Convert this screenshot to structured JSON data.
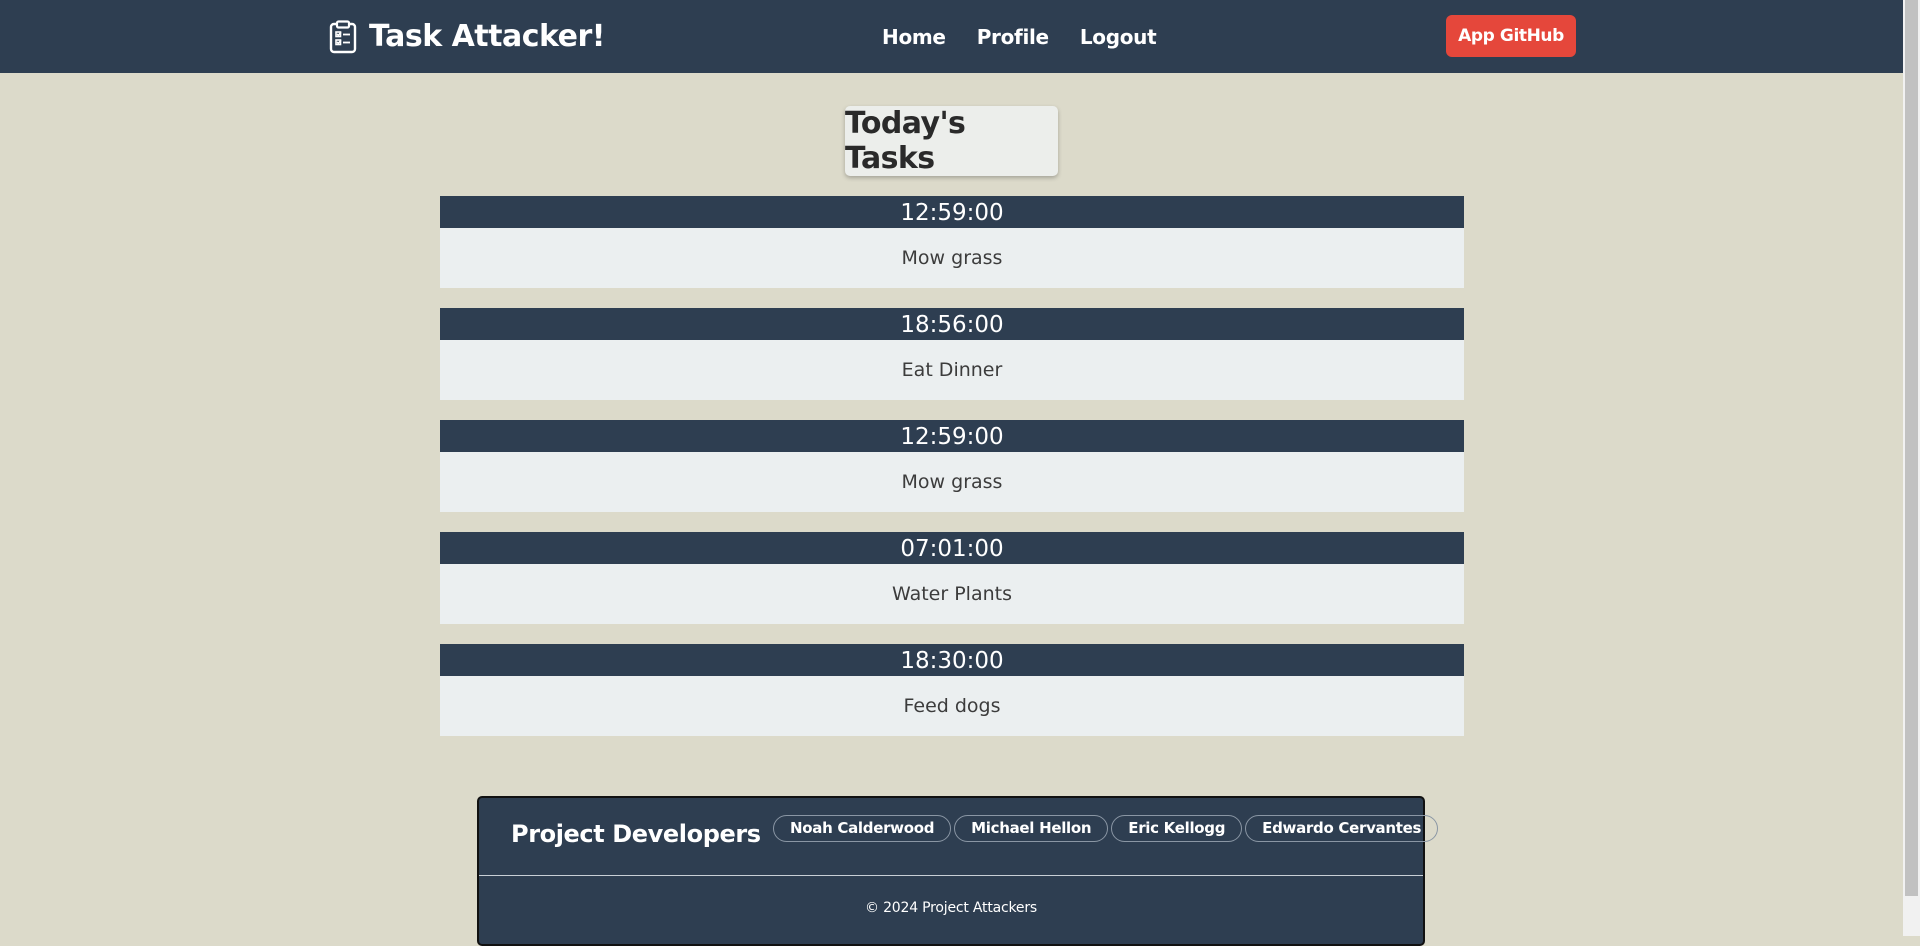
{
  "nav": {
    "brand": "Task Attacker!",
    "links": [
      "Home",
      "Profile",
      "Logout"
    ],
    "github_label": "App GitHub"
  },
  "main": {
    "title": "Today's Tasks",
    "tasks": [
      {
        "time": "12:59:00",
        "name": "Mow grass"
      },
      {
        "time": "18:56:00",
        "name": "Eat Dinner"
      },
      {
        "time": "12:59:00",
        "name": "Mow grass"
      },
      {
        "time": "07:01:00",
        "name": "Water Plants"
      },
      {
        "time": "18:30:00",
        "name": "Feed dogs"
      }
    ]
  },
  "footer": {
    "title": "Project Developers",
    "developers": [
      "Noah Calderwood",
      "Michael Hellon",
      "Eric Kellogg",
      "Edwardo Cervantes"
    ],
    "copyright": "© 2024 Project Attackers"
  },
  "colors": {
    "navbar": "#2e3e51",
    "page_background": "#dcdaca",
    "accent_button": "#e5473b",
    "task_body": "#ebeff0"
  },
  "icons": {
    "brand": "clipboard-check-icon"
  }
}
